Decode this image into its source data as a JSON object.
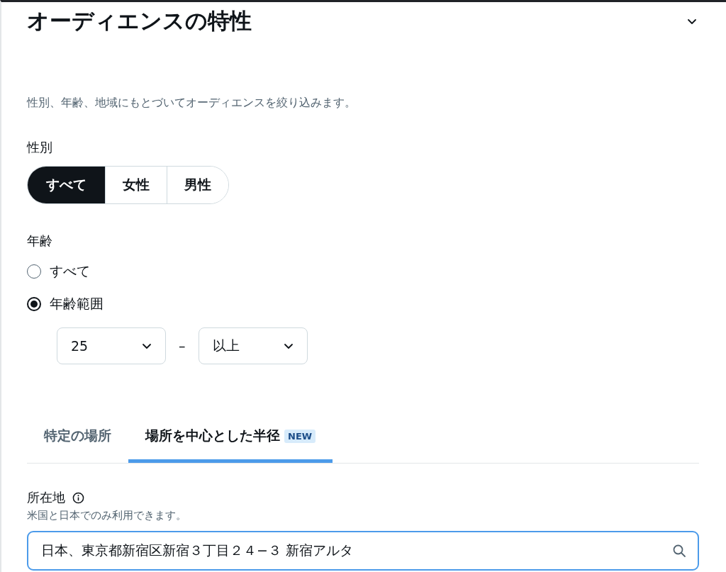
{
  "section": {
    "title": "オーディエンスの特性",
    "expanded": true,
    "description": "性別、年齢、地域にもとづいてオーディエンスを絞り込みます。"
  },
  "gender": {
    "label": "性別",
    "options": [
      {
        "label": "すべて",
        "selected": true
      },
      {
        "label": "女性",
        "selected": false
      },
      {
        "label": "男性",
        "selected": false
      }
    ]
  },
  "age": {
    "label": "年齢",
    "options": [
      {
        "label": "すべて",
        "selected": false
      },
      {
        "label": "年齢範囲",
        "selected": true
      }
    ],
    "from": "25",
    "separator": "–",
    "to": "以上"
  },
  "location_tabs": [
    {
      "label": "特定の場所",
      "selected": false
    },
    {
      "label": "場所を中心とした半径",
      "selected": true,
      "badge": "NEW"
    }
  ],
  "location": {
    "label": "所在地",
    "hint": "米国と日本でのみ利用できます。",
    "value": "日本、東京都新宿区新宿３丁目２４−３ 新宿アルタ"
  }
}
